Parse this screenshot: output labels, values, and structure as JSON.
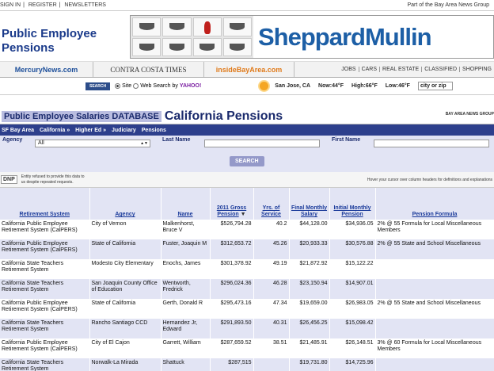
{
  "topbar": {
    "links": [
      "SIGN IN",
      "|",
      "REGISTER",
      "|",
      "NEWSLETTERS"
    ],
    "right": "Part of the Bay Area News Group"
  },
  "banner": {
    "title_line1": "Public Employee",
    "title_line2": "Pensions",
    "ad_brand": "SheppardMullin"
  },
  "nav": {
    "tabs": [
      "MercuryNews.com",
      "CONTRA COSTA TIMES",
      "insideBayArea.com"
    ],
    "links": [
      "JOBS",
      "CARS",
      "REAL ESTATE",
      "CLASSIFIED",
      "SHOPPING"
    ]
  },
  "search": {
    "button": "SEARCH",
    "opt_site": "Site",
    "opt_web": "Web Search by",
    "yahoo": "YAHOO!",
    "city": "San Jose, CA",
    "now": "Now:44°F",
    "high": "High:66°F",
    "low": "Low:46°F",
    "city_placeholder": "city or zip"
  },
  "db": {
    "tag": "Public Employee Salaries DATABASE",
    "name": "California Pensions",
    "source": "BAY AREA NEWS GROUP",
    "crumbs": [
      "SF Bay Area",
      "California »",
      "Higher Ed »",
      "Judiciary",
      "Pensions"
    ]
  },
  "filters": {
    "agency_label": "Agency",
    "agency_value": "All",
    "last_label": "Last Name",
    "first_label": "First Name",
    "search_button": "SEARCH"
  },
  "legend": {
    "dnp": "DNP",
    "note_line1": "Entity refused to provide this data to",
    "note_line2": "us despite repeated requests.",
    "hover": "Hover your cursor over column headers for definitions and explanations"
  },
  "table": {
    "headers": [
      "Retirement System",
      "Agency",
      "Name",
      "2011 Gross Pension",
      "Yrs. of Service",
      "Final Monthly Salary",
      "Initial Monthly Pension",
      "Pension Formula"
    ],
    "rows": [
      [
        "California Public Employee Retirement System (CalPERS)",
        "City of Vernon",
        "Malkenhorst, Bruce V",
        "$526,794.28",
        "40.2",
        "$44,128.00",
        "$34,936.05",
        "2% @ 55 Formula for Local Miscellaneous Members"
      ],
      [
        "California Public Employee Retirement System (CalPERS)",
        "State of California",
        "Fuster, Joaquin M",
        "$312,653.72",
        "45.26",
        "$20,933.33",
        "$30,576.88",
        "2% @ 55 State and School Miscellaneous"
      ],
      [
        "California State Teachers Retirement System",
        "Modesto City Elementary",
        "Enochs, James",
        "$301,378.92",
        "49.19",
        "$21,872.92",
        "$15,122.22",
        ""
      ],
      [
        "California State Teachers Retirement System",
        "San Joaquin County Office of Education",
        "Wentworth, Fredrick",
        "$296,024.36",
        "46.28",
        "$23,150.94",
        "$14,907.01",
        ""
      ],
      [
        "California Public Employee Retirement System (CalPERS)",
        "State of California",
        "Gerth, Donald R",
        "$295,473.16",
        "47.34",
        "$19,659.00",
        "$26,983.05",
        "2% @ 55 State and School Miscellaneous"
      ],
      [
        "California State Teachers Retirement System",
        "Rancho Santiago CCD",
        "Hernandez Jr, Edward",
        "$291,893.50",
        "40.31",
        "$26,456.25",
        "$15,098.42",
        ""
      ],
      [
        "California Public Employee Retirement System (CalPERS)",
        "City of El Cajon",
        "Garrett, William",
        "$287,659.52",
        "38.51",
        "$21,485.91",
        "$26,148.51",
        "3% @ 60 Formula for Local Miscellaneous Members"
      ],
      [
        "California State Teachers Retirement System",
        "Norwalk-La Mirada",
        "Shattuck",
        "$287,515",
        "",
        "$19,731.80",
        "$14,725.96",
        ""
      ]
    ]
  }
}
